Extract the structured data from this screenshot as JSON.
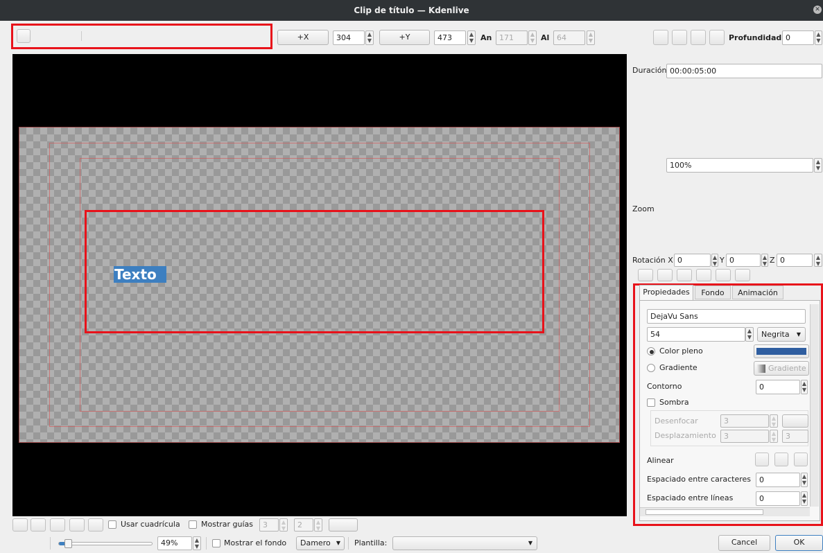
{
  "window": {
    "title": "Clip de título — Kdenlive",
    "close_icon": "close-icon"
  },
  "toolbar": {
    "x_button": "+X",
    "x_value": "304",
    "y_button": "+Y",
    "y_value": "473",
    "width_label": "An",
    "width_value": "171",
    "height_label": "Al",
    "height_value": "64",
    "depth_label": "Profundidad:",
    "depth_value": "0"
  },
  "canvas": {
    "text_item": "Texto",
    "text_color": "#ffffff",
    "selection_color": "#3d7fc0"
  },
  "right_panel": {
    "duration_label": "Duración",
    "duration_value": "00:00:05:00",
    "zoom_value": "100%",
    "zoom_label": "Zoom",
    "rotation_label": "Rotación X",
    "rot_x": "0",
    "y_label": "Y",
    "rot_y": "0",
    "z_label": "Z",
    "rot_z": "0"
  },
  "tabs": [
    {
      "label": "Propiedades",
      "active": true
    },
    {
      "label": "Fondo",
      "active": false
    },
    {
      "label": "Animación",
      "active": false
    }
  ],
  "properties": {
    "font_family": "DejaVu Sans",
    "font_size": "54",
    "font_weight": "Negrita",
    "solid_color_label": "Color pleno",
    "solid_color": "#2f5ea0",
    "gradient_label": "Gradiente",
    "gradient_button": "Gradiente",
    "outline_label": "Contorno",
    "outline_value": "0",
    "shadow_label": "Sombra",
    "blur_label": "Desenfocar",
    "blur_value": "3",
    "offset_label": "Desplazamiento",
    "offset_value": "3",
    "offset_value2": "3",
    "align_label": "Alinear",
    "letter_spacing_label": "Espaciado entre caracteres",
    "letter_spacing_value": "0",
    "line_spacing_label": "Espaciado entre líneas",
    "line_spacing_value": "0"
  },
  "bottom": {
    "grid_label": "Usar cuadrícula",
    "guides_label": "Mostrar guías",
    "guides_h": "3",
    "guides_v": "2",
    "zoom_value": "49%",
    "show_bg_label": "Mostrar el fondo",
    "bg_option": "Damero",
    "template_label": "Plantilla:",
    "template_value": "",
    "cancel_button": "Cancel",
    "ok_button": "OK"
  }
}
